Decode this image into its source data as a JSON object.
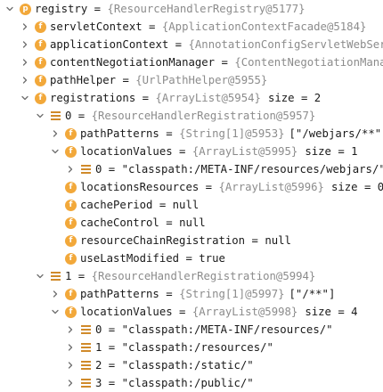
{
  "tree": {
    "rows": [
      {
        "indent": 0,
        "expander": "down",
        "icon": "p",
        "name": "registry",
        "ref": "{ResourceHandlerRegistry@5177}"
      },
      {
        "indent": 1,
        "expander": "right",
        "icon": "f",
        "name": "servletContext",
        "ref": "{ApplicationContextFacade@5184}"
      },
      {
        "indent": 1,
        "expander": "right",
        "icon": "f",
        "name": "applicationContext",
        "ref": "{AnnotationConfigServletWebServe"
      },
      {
        "indent": 1,
        "expander": "right",
        "icon": "f",
        "name": "contentNegotiationManager",
        "ref": "{ContentNegotiationManage"
      },
      {
        "indent": 1,
        "expander": "right",
        "icon": "f",
        "name": "pathHelper",
        "ref": "{UrlPathHelper@5955}"
      },
      {
        "indent": 1,
        "expander": "down",
        "icon": "f",
        "name": "registrations",
        "ref": "{ArrayList@5954}",
        "size": "size = 2"
      },
      {
        "indent": 2,
        "expander": "down",
        "icon": "elem",
        "name": "0",
        "ref": "{ResourceHandlerRegistration@5957}"
      },
      {
        "indent": 3,
        "expander": "right",
        "icon": "f",
        "name": "pathPatterns",
        "ref": "{String[1]@5953}",
        "value": "[\"/webjars/**\"]"
      },
      {
        "indent": 3,
        "expander": "down",
        "icon": "f",
        "name": "locationValues",
        "ref": "{ArrayList@5995}",
        "size": "size = 1"
      },
      {
        "indent": 4,
        "expander": "right",
        "icon": "elem",
        "name": "0",
        "value": "\"classpath:/META-INF/resources/webjars/\""
      },
      {
        "indent": 3,
        "expander": "none",
        "icon": "f",
        "name": "locationsResources",
        "ref": "{ArrayList@5996}",
        "size": "size = 0"
      },
      {
        "indent": 3,
        "expander": "none",
        "icon": "f",
        "name": "cachePeriod",
        "value": "null"
      },
      {
        "indent": 3,
        "expander": "none",
        "icon": "f",
        "name": "cacheControl",
        "value": "null"
      },
      {
        "indent": 3,
        "expander": "none",
        "icon": "f",
        "name": "resourceChainRegistration",
        "value": "null"
      },
      {
        "indent": 3,
        "expander": "none",
        "icon": "f",
        "name": "useLastModified",
        "value": "true"
      },
      {
        "indent": 2,
        "expander": "down",
        "icon": "elem",
        "name": "1",
        "ref": "{ResourceHandlerRegistration@5994}"
      },
      {
        "indent": 3,
        "expander": "right",
        "icon": "f",
        "name": "pathPatterns",
        "ref": "{String[1]@5997}",
        "value": "[\"/**\"]"
      },
      {
        "indent": 3,
        "expander": "down",
        "icon": "f",
        "name": "locationValues",
        "ref": "{ArrayList@5998}",
        "size": "size = 4"
      },
      {
        "indent": 4,
        "expander": "right",
        "icon": "elem",
        "name": "0",
        "value": "\"classpath:/META-INF/resources/\""
      },
      {
        "indent": 4,
        "expander": "right",
        "icon": "elem",
        "name": "1",
        "value": "\"classpath:/resources/\""
      },
      {
        "indent": 4,
        "expander": "right",
        "icon": "elem",
        "name": "2",
        "value": "\"classpath:/static/\""
      },
      {
        "indent": 4,
        "expander": "right",
        "icon": "elem",
        "name": "3",
        "value": "\"classpath:/public/\""
      }
    ]
  },
  "labels": {
    "equals": " = ",
    "field_icon_glyph": "f",
    "param_icon_glyph": "p"
  },
  "colors": {
    "field_icon": "#f2a83a",
    "element_icon": "#d08a2a",
    "reference_text": "#8c8c8c",
    "text": "#1a1a1a",
    "background": "#ffffff"
  }
}
